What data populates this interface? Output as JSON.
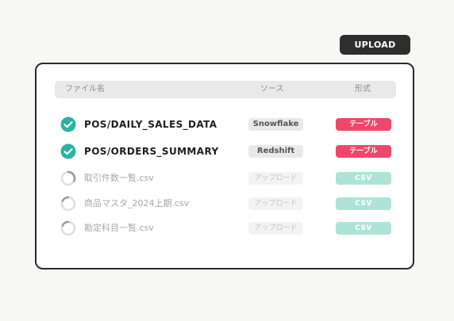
{
  "upload": {
    "label": "UPLOAD"
  },
  "table": {
    "headers": {
      "name": "ファイル名",
      "source": "ソース",
      "format": "形式"
    },
    "rows": [
      {
        "name": "POS/DAILY_SALES_DATA",
        "source": "Snowflake",
        "format": "テーブル",
        "status": "done"
      },
      {
        "name": "POS/ORDERS_SUMMARY",
        "source": "Redshift",
        "format": "テーブル",
        "status": "done"
      },
      {
        "name": "取引件数一覧.csv",
        "source": "アップロード",
        "format": "CSV",
        "status": "loading"
      },
      {
        "name": "商品マスタ_2024上期.csv",
        "source": "アップロード",
        "format": "CSV",
        "status": "loading"
      },
      {
        "name": "勘定科目一覧.csv",
        "source": "アップロード",
        "format": "CSV",
        "status": "loading"
      }
    ]
  },
  "colors": {
    "done_check": "#2ab3a0",
    "table_badge": "#ee4868",
    "csv_badge": "#aee4d8",
    "loading_ring": "#d9d9d9",
    "loading_arc": "#9a9a9a"
  },
  "icons": {
    "done": "check-circle-icon",
    "loading": "loading-spinner-icon"
  }
}
